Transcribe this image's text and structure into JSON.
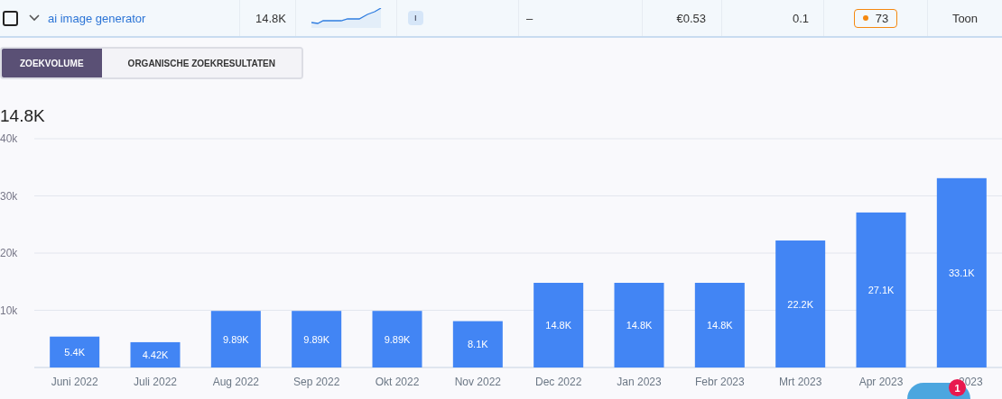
{
  "keyword_row": {
    "checked": false,
    "expanded": false,
    "keyword": "ai image generator",
    "volume": "14.8K",
    "intent": "I",
    "column_5": "–",
    "cpc": "€0.53",
    "competition": "0.1",
    "difficulty": {
      "value": "73",
      "color": "#f5880f"
    },
    "action": "Toon"
  },
  "tabs": [
    {
      "label": "ZOEKVOLUME",
      "selected": true
    },
    {
      "label": "ORGANISCHE ZOEKRESULTATEN",
      "selected": false
    }
  ],
  "current_value": "14.8K",
  "chart": {
    "chart_data": {
      "type": "bar",
      "categories": [
        "Juni 2022",
        "Juli 2022",
        "Aug 2022",
        "Sep 2022",
        "Okt 2022",
        "Nov 2022",
        "Dec 2022",
        "Jan 2023",
        "Febr 2023",
        "Mrt 2023",
        "Apr 2023",
        "2023"
      ],
      "series": [
        {
          "color": "#4285f4",
          "values": [
            5400,
            4420,
            9890,
            9890,
            9890,
            8100,
            14800,
            14800,
            14800,
            22200,
            27100,
            33100
          ]
        }
      ],
      "value_labels": [
        "5.4K",
        "4.42K",
        "9.89K",
        "9.89K",
        "9.89K",
        "8.1K",
        "14.8K",
        "14.8K",
        "14.8K",
        "22.2K",
        "27.1K",
        "33.1K"
      ],
      "ylim": [
        0,
        40000
      ],
      "yticks": [
        {
          "value": 10000,
          "label": "10k"
        },
        {
          "value": 20000,
          "label": "20k"
        },
        {
          "value": 30000,
          "label": "30k"
        },
        {
          "value": 40000,
          "label": "40k"
        }
      ],
      "grid": true
    }
  },
  "chat_widget": {
    "badge": "1"
  }
}
